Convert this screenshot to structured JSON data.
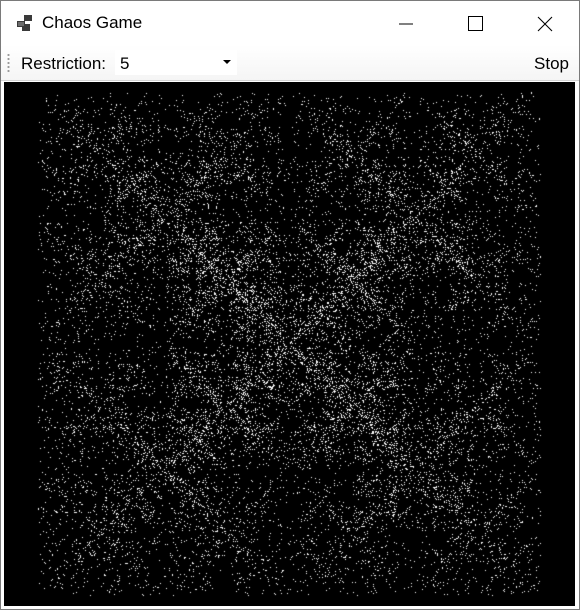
{
  "window": {
    "title": "Chaos Game",
    "controls": [
      "minimize-icon",
      "maximize-icon",
      "close-icon"
    ]
  },
  "toolbar": {
    "restriction_label": "Restriction:",
    "restriction_value": "5",
    "stop_label": "Stop"
  },
  "canvas": {
    "background": "#000000",
    "point_color": "#ffffff",
    "vertices": 4,
    "restriction": 5
  }
}
